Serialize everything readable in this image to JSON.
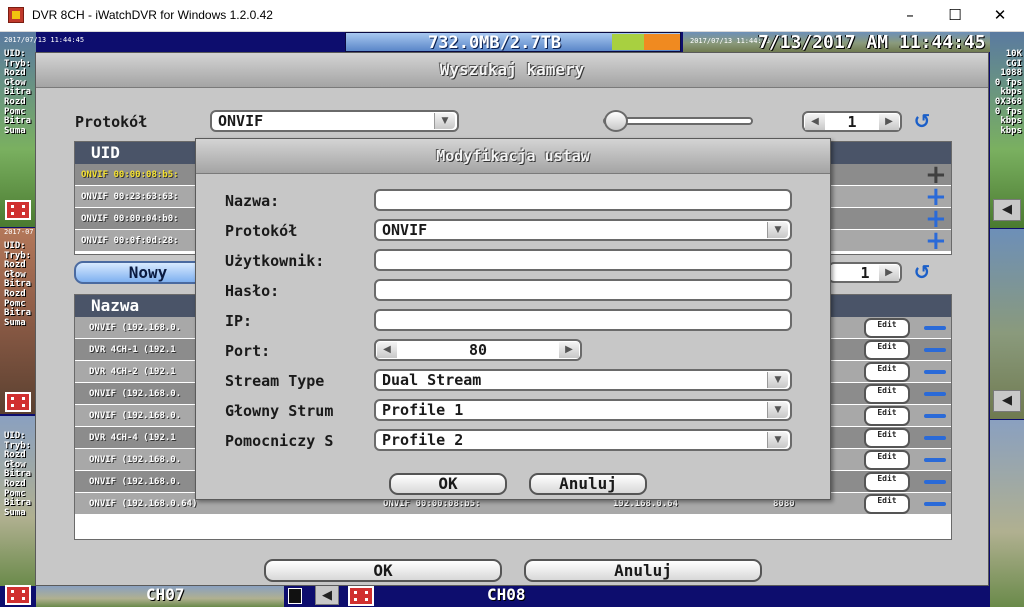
{
  "window": {
    "title": "DVR 8CH - iWatchDVR for Windows 1.2.0.42",
    "icons": {
      "app": "dvr-app-icon",
      "minimize": "minimize-icon",
      "maximize": "maximize-icon",
      "close": "close-icon"
    }
  },
  "dvr": {
    "storage": {
      "text": "732.0MB/2.7TB",
      "colors": {
        "green": "#a8d040",
        "orange": "#f08a20"
      }
    },
    "clock": "7/13/2017 AM 11:44:45",
    "left_cam_stamp": "2017/07/13 11:44:45",
    "top_cam_stamp": "2017/07/13 11:44:45",
    "mid_cam_stamp": "2017-07",
    "osd_top": "UID:\nTryb:\nRozd\nGłow\nBitra\nRozd\nPomc\nBitra\nSuma",
    "osd_mid": "UID:\nTryb:\nRozd\nGłow\nBitra\nRozd\nPomc\nBitra\nSuma",
    "osd_bottom": "UID:\nTryb:\nRozd\nGłow\nBitra\nRozd\nPomc\nBitra\nSuma",
    "osd_right": "10K\nCGI\n1088\n0 fps\nkbps\n0X368\n0 fps\nkbps\nkbps",
    "ch_left": "CH07",
    "ch_right": "CH08"
  },
  "search_dialog": {
    "title": "Wyszukaj kamery",
    "protocol_label": "Protokół",
    "protocol_value": "ONVIF",
    "page_top": "1",
    "page_mid": "1",
    "uid_header": "UID",
    "uid_rows": [
      {
        "text": "ONVIF 00:00:08:b5:",
        "selected": true
      },
      {
        "text": "ONVIF 00:23:63:63:",
        "selected": false
      },
      {
        "text": "ONVIF 00:00:04:b0:",
        "selected": false
      },
      {
        "text": "ONVIF 00:0f:0d:28:",
        "selected": false
      }
    ],
    "new_button": "Nowy",
    "name_header": "Nazwa",
    "device_rows": [
      {
        "name": "ONVIF (192.168.0.",
        "uid": "",
        "ip": "",
        "port": "",
        "edit": "Edit"
      },
      {
        "name": "DVR 4CH-1 (192.1",
        "uid": "",
        "ip": "",
        "port": "",
        "edit": "Edit"
      },
      {
        "name": "DVR 4CH-2 (192.1",
        "uid": "",
        "ip": "",
        "port": "",
        "edit": "Edit"
      },
      {
        "name": "ONVIF (192.168.0.",
        "uid": "",
        "ip": "",
        "port": "",
        "edit": "Edit"
      },
      {
        "name": "ONVIF (192.168.0.",
        "uid": "",
        "ip": "",
        "port": "",
        "edit": "Edit"
      },
      {
        "name": "DVR 4CH-4 (192.1",
        "uid": "",
        "ip": "",
        "port": "",
        "edit": "Edit"
      },
      {
        "name": "ONVIF (192.168.0.",
        "uid": "",
        "ip": "",
        "port": "",
        "edit": "Edit"
      },
      {
        "name": "ONVIF (192.168.0.",
        "uid": "",
        "ip": "",
        "port": "",
        "edit": "Edit"
      },
      {
        "name": "ONVIF (192.168.0.64)",
        "uid": "ONVIF 00:00:08:b5:",
        "ip": "192.168.0.64",
        "port": "8080",
        "edit": "Edit"
      }
    ],
    "ok_button": "OK",
    "cancel_button": "Anuluj"
  },
  "modify_dialog": {
    "title": "Modyfikacja ustaw",
    "name_label": "Nazwa:",
    "name_value": "",
    "protocol_label": "Protokół",
    "protocol_value": "ONVIF",
    "user_label": "Użytkownik:",
    "user_value": "",
    "password_label": "Hasło:",
    "password_value": "",
    "ip_label": "IP:",
    "ip_value": "",
    "port_label": "Port:",
    "port_value": "80",
    "stream_type_label": "Stream Type",
    "stream_type_value": "Dual Stream",
    "main_stream_label": "Głowny Strum",
    "main_stream_value": "Profile 1",
    "sub_stream_label": "Pomocniczy S",
    "sub_stream_value": "Profile 2",
    "ok_button": "OK",
    "cancel_button": "Anuluj"
  }
}
